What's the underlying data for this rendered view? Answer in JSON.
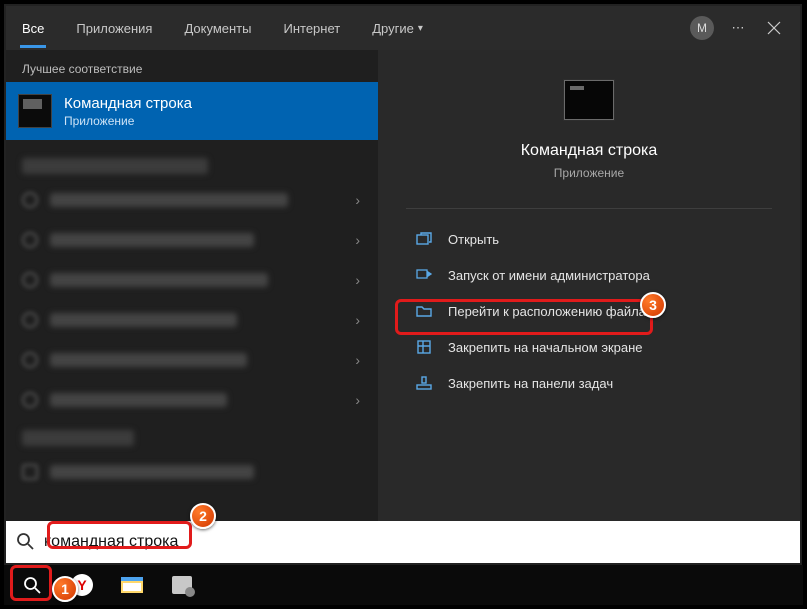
{
  "header": {
    "tabs": [
      {
        "label": "Все",
        "active": true
      },
      {
        "label": "Приложения",
        "active": false
      },
      {
        "label": "Документы",
        "active": false
      },
      {
        "label": "Интернет",
        "active": false
      },
      {
        "label": "Другие",
        "active": false,
        "dropdown": true
      }
    ],
    "avatar_initial": "M"
  },
  "left": {
    "best_match_label": "Лучшее соответствие",
    "best_match": {
      "title": "Командная строка",
      "subtitle": "Приложение"
    }
  },
  "right": {
    "title": "Командная строка",
    "subtitle": "Приложение",
    "actions": [
      {
        "icon": "open",
        "label": "Открыть"
      },
      {
        "icon": "admin",
        "label": "Запуск от имени администратора",
        "highlight": true
      },
      {
        "icon": "folder",
        "label": "Перейти к расположению файла"
      },
      {
        "icon": "pin-start",
        "label": "Закрепить на начальном экране"
      },
      {
        "icon": "pin-task",
        "label": "Закрепить на панели задач"
      }
    ]
  },
  "search": {
    "value": "командная строка"
  },
  "annotations": {
    "1": "search-taskbar-button",
    "2": "search-input-text",
    "3": "run-as-admin-action"
  }
}
